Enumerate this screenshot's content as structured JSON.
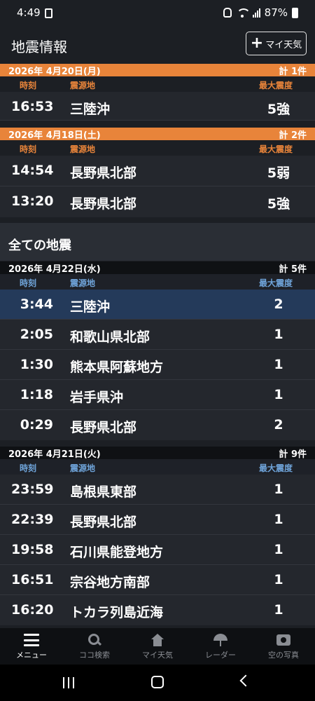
{
  "status_bar": {
    "time": "4:49",
    "battery": "87%"
  },
  "header": {
    "title": "地震情報",
    "my_weather_label": "マイ天気"
  },
  "my_section": {
    "groups": [
      {
        "date": "2026年 4月20日(月)",
        "count": "計 1件",
        "col_time": "時刻",
        "col_place": "震源地",
        "col_intensity": "最大震度",
        "rows": [
          {
            "time": "16:53",
            "place": "三陸沖",
            "intensity": "5強"
          }
        ]
      },
      {
        "date": "2026年 4月18日(土)",
        "count": "計 2件",
        "col_time": "時刻",
        "col_place": "震源地",
        "col_intensity": "最大震度",
        "rows": [
          {
            "time": "14:54",
            "place": "長野県北部",
            "intensity": "5弱"
          },
          {
            "time": "13:20",
            "place": "長野県北部",
            "intensity": "5強"
          }
        ]
      }
    ]
  },
  "all_section": {
    "title": "全ての地震",
    "groups": [
      {
        "date": "2026年 4月22日(水)",
        "count": "計 5件",
        "col_time": "時刻",
        "col_place": "震源地",
        "col_intensity": "最大震度",
        "rows": [
          {
            "time": "3:44",
            "place": "三陸沖",
            "intensity": "2"
          },
          {
            "time": "2:05",
            "place": "和歌山県北部",
            "intensity": "1"
          },
          {
            "time": "1:30",
            "place": "熊本県阿蘇地方",
            "intensity": "1"
          },
          {
            "time": "1:18",
            "place": "岩手県沖",
            "intensity": "1"
          },
          {
            "time": "0:29",
            "place": "長野県北部",
            "intensity": "2"
          }
        ]
      },
      {
        "date": "2026年 4月21日(火)",
        "count": "計 9件",
        "col_time": "時刻",
        "col_place": "震源地",
        "col_intensity": "最大震度",
        "rows": [
          {
            "time": "23:59",
            "place": "島根県東部",
            "intensity": "1"
          },
          {
            "time": "22:39",
            "place": "長野県北部",
            "intensity": "1"
          },
          {
            "time": "19:58",
            "place": "石川県能登地方",
            "intensity": "1"
          },
          {
            "time": "16:51",
            "place": "宗谷地方南部",
            "intensity": "1"
          },
          {
            "time": "16:20",
            "place": "トカラ列島近海",
            "intensity": "1"
          }
        ]
      }
    ]
  },
  "tab_bar": {
    "tabs": [
      {
        "label": "メニュー",
        "icon": "menu-icon"
      },
      {
        "label": "ココ検索",
        "icon": "search-icon"
      },
      {
        "label": "マイ天気",
        "icon": "house-icon"
      },
      {
        "label": "レーダー",
        "icon": "radar-icon"
      },
      {
        "label": "空の写真",
        "icon": "camera-icon"
      }
    ]
  },
  "colors": {
    "accent_orange": "#e8843a",
    "selected_row": "#243a5a",
    "header_blue": "#6fa4da"
  }
}
